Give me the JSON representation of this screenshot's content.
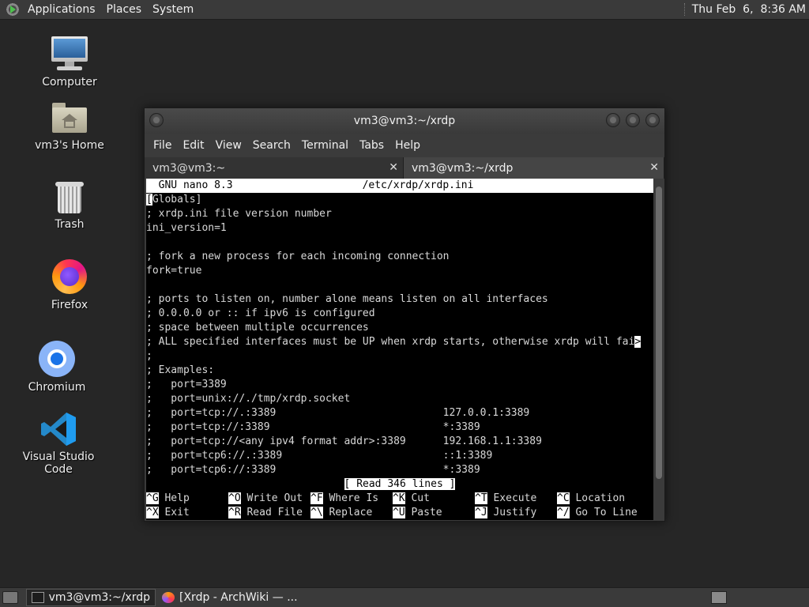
{
  "top_panel": {
    "menus": [
      "Applications",
      "Places",
      "System"
    ],
    "clock": "Thu Feb  6,  8:36 AM"
  },
  "desktop_icons": [
    {
      "label": "Computer",
      "icon": "computer-icon"
    },
    {
      "label": "vm3's Home",
      "icon": "home-folder-icon"
    },
    {
      "label": "Trash",
      "icon": "trash-icon"
    },
    {
      "label": "Firefox",
      "icon": "firefox-icon"
    },
    {
      "label": "Chromium",
      "icon": "chromium-icon"
    },
    {
      "label": "Visual Studio Code",
      "icon": "vscode-icon"
    }
  ],
  "window": {
    "title": "vm3@vm3:~/xrdp",
    "menus": [
      "File",
      "Edit",
      "View",
      "Search",
      "Terminal",
      "Tabs",
      "Help"
    ],
    "tabs": [
      {
        "label": "vm3@vm3:~",
        "active": false
      },
      {
        "label": "vm3@vm3:~/xrdp",
        "active": true
      }
    ]
  },
  "nano": {
    "header_left": "  GNU nano 8.3",
    "header_file": "/etc/xrdp/xrdp.ini",
    "cursor_char": "[",
    "first_line_rest": "Globals]",
    "lines": [
      "; xrdp.ini file version number",
      "ini_version=1",
      "",
      "; fork a new process for each incoming connection",
      "fork=true",
      "",
      "; ports to listen on, number alone means listen on all interfaces",
      "; 0.0.0.0 or :: if ipv6 is configured",
      "; space between multiple occurrences",
      "; ALL specified interfaces must be UP when xrdp starts, otherwise xrdp will fai",
      ";",
      "; Examples:",
      ";   port=3389",
      ";   port=unix://./tmp/xrdp.socket",
      ";   port=tcp://.:3389                           127.0.0.1:3389",
      ";   port=tcp://:3389                            *:3389",
      ";   port=tcp://<any ipv4 format addr>:3389      192.168.1.1:3389",
      ";   port=tcp6://.:3389                          ::1:3389",
      ";   port=tcp6://:3389                           *:3389"
    ],
    "truncation_marker": ">",
    "status": "[ Read 346 lines ]",
    "shortcuts_row1": [
      {
        "key": "^G",
        "label": "Help"
      },
      {
        "key": "^O",
        "label": "Write Out"
      },
      {
        "key": "^F",
        "label": "Where Is"
      },
      {
        "key": "^K",
        "label": "Cut"
      },
      {
        "key": "^T",
        "label": "Execute"
      },
      {
        "key": "^C",
        "label": "Location"
      }
    ],
    "shortcuts_row2": [
      {
        "key": "^X",
        "label": "Exit"
      },
      {
        "key": "^R",
        "label": "Read File"
      },
      {
        "key": "^\\",
        "label": "Replace"
      },
      {
        "key": "^U",
        "label": "Paste"
      },
      {
        "key": "^J",
        "label": "Justify"
      },
      {
        "key": "^/",
        "label": "Go To Line"
      }
    ]
  },
  "taskbar": {
    "tasks": [
      {
        "label": "vm3@vm3:~/xrdp",
        "icon": "terminal-icon",
        "active": true
      },
      {
        "label": "[Xrdp - ArchWiki — ...",
        "icon": "firefox-icon",
        "active": false
      }
    ]
  }
}
